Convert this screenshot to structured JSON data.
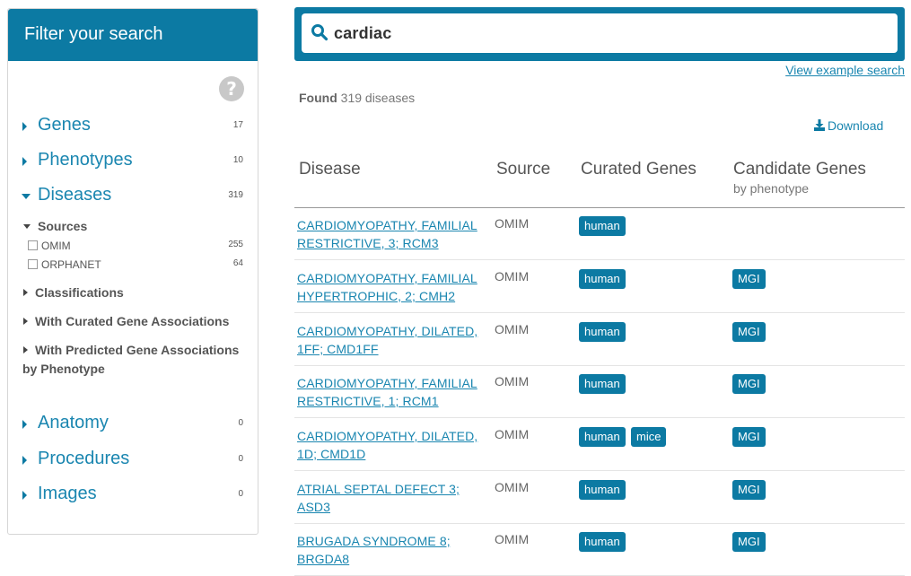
{
  "sidebar": {
    "title": "Filter your search",
    "facets": [
      {
        "label": "Genes",
        "count": "17"
      },
      {
        "label": "Phenotypes",
        "count": "10"
      },
      {
        "label": "Diseases",
        "count": "319"
      },
      {
        "label": "Anatomy",
        "count": "0"
      },
      {
        "label": "Procedures",
        "count": "0"
      },
      {
        "label": "Images",
        "count": "0"
      }
    ],
    "sources_label": "Sources",
    "source_options": [
      {
        "label": "OMIM",
        "count": "255"
      },
      {
        "label": "ORPHANET",
        "count": "64"
      }
    ],
    "classifications_label": "Classifications",
    "curated_label": "With Curated Gene Associations",
    "predicted_label_1": "With Predicted Gene Associations",
    "predicted_label_2": "by Phenotype"
  },
  "search": {
    "value": "cardiac",
    "example_link": "View example search"
  },
  "results": {
    "found_prefix": "Found",
    "found_text": "319 diseases",
    "download_label": "Download",
    "columns": {
      "disease": "Disease",
      "source": "Source",
      "curated": "Curated Genes",
      "candidate": "Candidate Genes",
      "candidate_sub": "by phenotype"
    },
    "rows": [
      {
        "line1": "CARDIOMYOPATHY, FAMILIAL",
        "line2": "RESTRICTIVE, 3; RCM3",
        "source": "OMIM",
        "curated": [
          "human"
        ],
        "candidate": []
      },
      {
        "line1": "CARDIOMYOPATHY, FAMILIAL",
        "line2": "HYPERTROPHIC, 2; CMH2",
        "source": "OMIM",
        "curated": [
          "human"
        ],
        "candidate": [
          "MGI"
        ]
      },
      {
        "line1": "CARDIOMYOPATHY, DILATED,",
        "line2": "1FF; CMD1FF",
        "source": "OMIM",
        "curated": [
          "human"
        ],
        "candidate": [
          "MGI"
        ]
      },
      {
        "line1": "CARDIOMYOPATHY, FAMILIAL",
        "line2": "RESTRICTIVE, 1; RCM1",
        "source": "OMIM",
        "curated": [
          "human"
        ],
        "candidate": [
          "MGI"
        ]
      },
      {
        "line1": "CARDIOMYOPATHY, DILATED,",
        "line2": "1D; CMD1D",
        "source": "OMIM",
        "curated": [
          "human",
          "mice"
        ],
        "candidate": [
          "MGI"
        ]
      },
      {
        "line1": "ATRIAL SEPTAL DEFECT 3;",
        "line2": "ASD3",
        "source": "OMIM",
        "curated": [
          "human"
        ],
        "candidate": [
          "MGI"
        ]
      },
      {
        "line1": "BRUGADA SYNDROME 8;",
        "line2": "BRGDA8",
        "source": "OMIM",
        "curated": [
          "human"
        ],
        "candidate": [
          "MGI"
        ]
      }
    ]
  },
  "colors": {
    "accent": "#0c7aa3",
    "link": "#1a86b0"
  }
}
